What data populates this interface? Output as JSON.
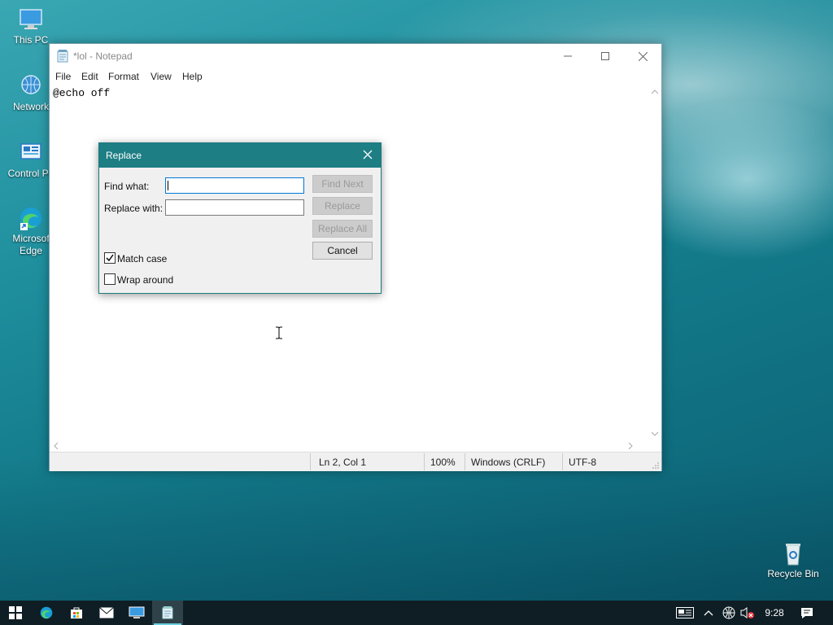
{
  "desktop": {
    "icons": [
      {
        "label": "This PC",
        "icon": "computer-icon"
      },
      {
        "label": "Network",
        "icon": "network-icon"
      },
      {
        "label": "Control Pa",
        "icon": "control-panel-icon"
      },
      {
        "label": "Microsof\nEdge",
        "icon": "edge-icon"
      },
      {
        "label": "Recycle Bin",
        "icon": "recycle-bin-icon"
      }
    ]
  },
  "notepad": {
    "title": "*lol - Notepad",
    "menu": [
      "File",
      "Edit",
      "Format",
      "View",
      "Help"
    ],
    "content": "@echo off",
    "status": {
      "position": "Ln 2, Col 1",
      "zoom": "100%",
      "line_endings": "Windows (CRLF)",
      "encoding": "UTF-8"
    }
  },
  "replace_dialog": {
    "title": "Replace",
    "find_label": "Find what:",
    "replace_label": "Replace with:",
    "find_value": "",
    "replace_value": "",
    "buttons": {
      "find_next": "Find Next",
      "replace": "Replace",
      "replace_all": "Replace All",
      "cancel": "Cancel"
    },
    "match_case_label": "Match case",
    "match_case_checked": true,
    "wrap_around_label": "Wrap around",
    "wrap_around_checked": false
  },
  "taskbar": {
    "clock": "9:28",
    "items": [
      "start-icon",
      "edge-icon",
      "store-icon",
      "mail-icon",
      "computer-icon",
      "notepad-icon"
    ],
    "tray": [
      "news-icon",
      "chevron-up-icon",
      "globe-icon",
      "volume-muted-icon",
      "notification-icon"
    ]
  }
}
